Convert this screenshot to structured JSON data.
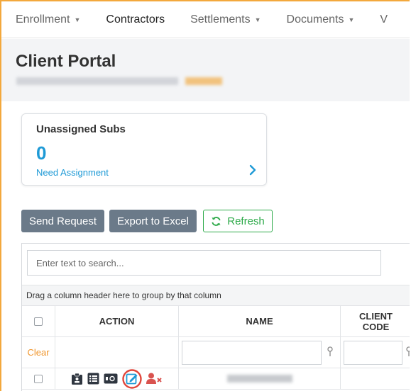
{
  "nav": {
    "items": [
      {
        "label": "Enrollment",
        "dropdown": true,
        "active": false
      },
      {
        "label": "Contractors",
        "dropdown": false,
        "active": true
      },
      {
        "label": "Settlements",
        "dropdown": true,
        "active": false
      },
      {
        "label": "Documents",
        "dropdown": true,
        "active": false
      },
      {
        "label": "V",
        "dropdown": false,
        "active": false
      }
    ],
    "caret_glyph": "▼"
  },
  "header": {
    "title": "Client Portal"
  },
  "card": {
    "title": "Unassigned Subs",
    "count": "0",
    "link_label": "Need Assignment",
    "accent_color": "#1e9ad6"
  },
  "toolbar": {
    "send_request_label": "Send Request",
    "export_label": "Export to Excel",
    "refresh_label": "Refresh",
    "refresh_color": "#2eaa4a"
  },
  "grid": {
    "search_placeholder": "Enter text to search...",
    "group_panel_text": "Drag a column header here to group by that column",
    "columns": {
      "action": "ACTION",
      "name": "NAME",
      "client_code_line1": "CLIENT",
      "client_code_line2": "CODE"
    },
    "filter_clear_label": "Clear",
    "row_action_icons": [
      "clipboard-badge-icon",
      "list-icon",
      "id-card-icon",
      "edit-icon",
      "remove-user-icon"
    ]
  },
  "colors": {
    "frame_border": "#f3a83c",
    "clear_link": "#f0962d",
    "edit_highlight_ring": "#e0453a",
    "remove_user": "#d9534f",
    "dark_icon": "#2f3640"
  }
}
